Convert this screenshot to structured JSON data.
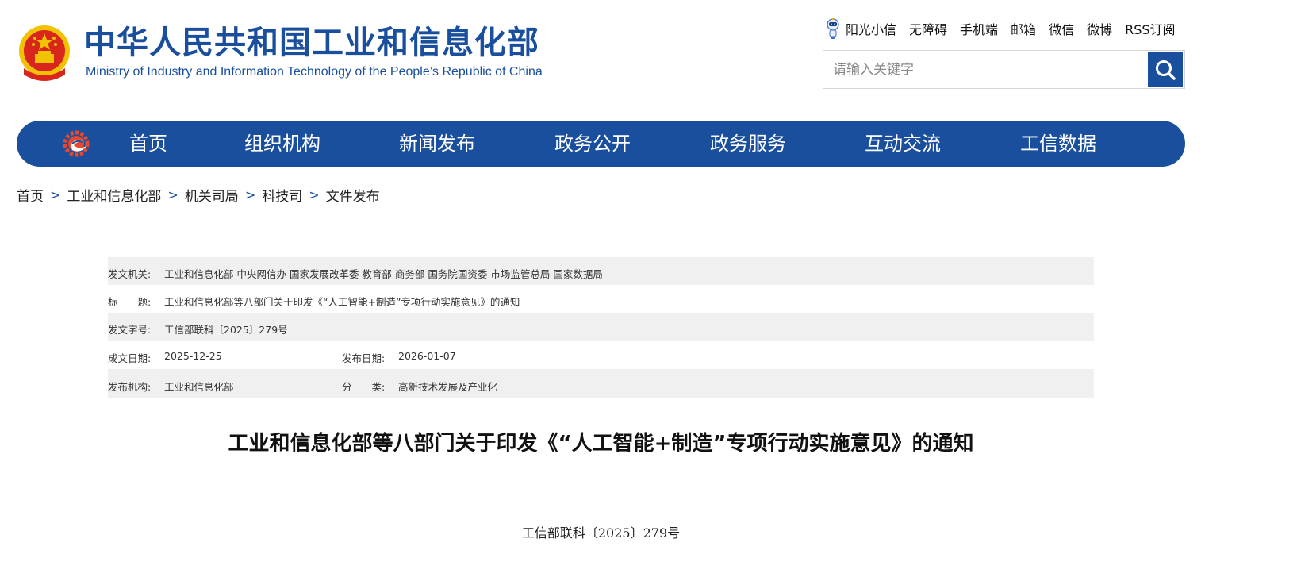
{
  "header": {
    "site_title": "中华人民共和国工业和信息化部",
    "site_subtitle": "Ministry of Industry and Information Technology of the People’s Republic of China",
    "top_links": [
      "阳光小信",
      "无障碍",
      "手机端",
      "邮箱",
      "微信",
      "微博",
      "RSS订阅"
    ],
    "search": {
      "placeholder": "请输入关键字",
      "value": ""
    }
  },
  "nav": {
    "items": [
      "首页",
      "组织机构",
      "新闻发布",
      "政务公开",
      "政务服务",
      "互动交流",
      "工信数据"
    ]
  },
  "breadcrumb": [
    "首页",
    "工业和信息化部",
    "机关司局",
    "科技司",
    "文件发布"
  ],
  "info": {
    "issuer_label": "发文机关:",
    "issuer_value": "工业和信息化部 中央网信办 国家发展改革委 教育部 商务部 国务院国资委 市场监管总局 国家数据局",
    "title_label": "标　　题:",
    "title_value": "工业和信息化部等八部门关于印发《“人工智能+制造”专项行动实施意见》的通知",
    "docno_label": "发文字号:",
    "docno_value": "工信部联科〔2025〕279号",
    "created_label": "成文日期:",
    "created_value": "2025-12-25",
    "published_label": "发布日期:",
    "published_value": "2026-01-07",
    "org_label": "发布机构:",
    "org_value": "工业和信息化部",
    "category_label": "分　　类:",
    "category_value": "高新技术发展及产业化"
  },
  "document": {
    "title": "工业和信息化部等八部门关于印发《“人工智能+制造”专项行动实施意见》的通知",
    "number": "工信部联科〔2025〕279号"
  },
  "colors": {
    "brand_blue": "#1a4f9e",
    "row_alt": "#f0f0f0",
    "emblem_red": "#d9261c",
    "emblem_gold": "#f2c200"
  }
}
